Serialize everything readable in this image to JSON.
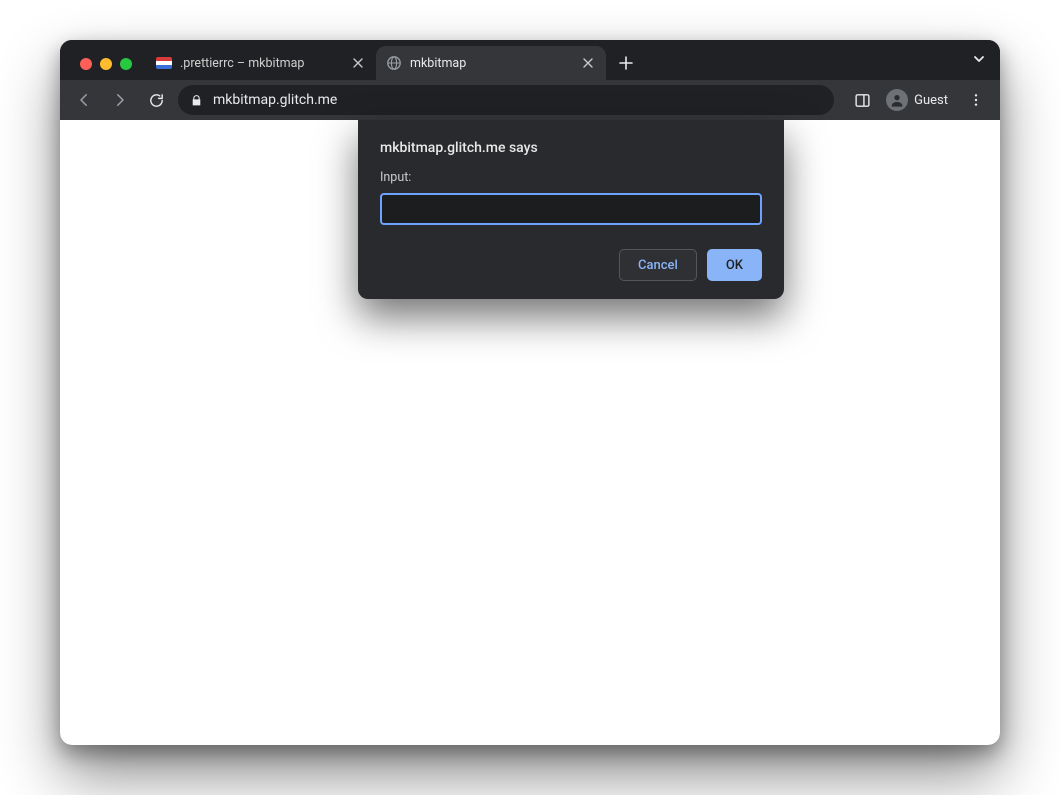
{
  "tabs": [
    {
      "title": ".prettierrc – mkbitmap",
      "active": false,
      "favicon": "stripes"
    },
    {
      "title": "mkbitmap",
      "active": true,
      "favicon": "globe"
    }
  ],
  "toolbar": {
    "url": "mkbitmap.glitch.me",
    "profile_label": "Guest"
  },
  "prompt": {
    "origin_says": "mkbitmap.glitch.me says",
    "label": "Input:",
    "value": "",
    "cancel_label": "Cancel",
    "ok_label": "OK"
  }
}
